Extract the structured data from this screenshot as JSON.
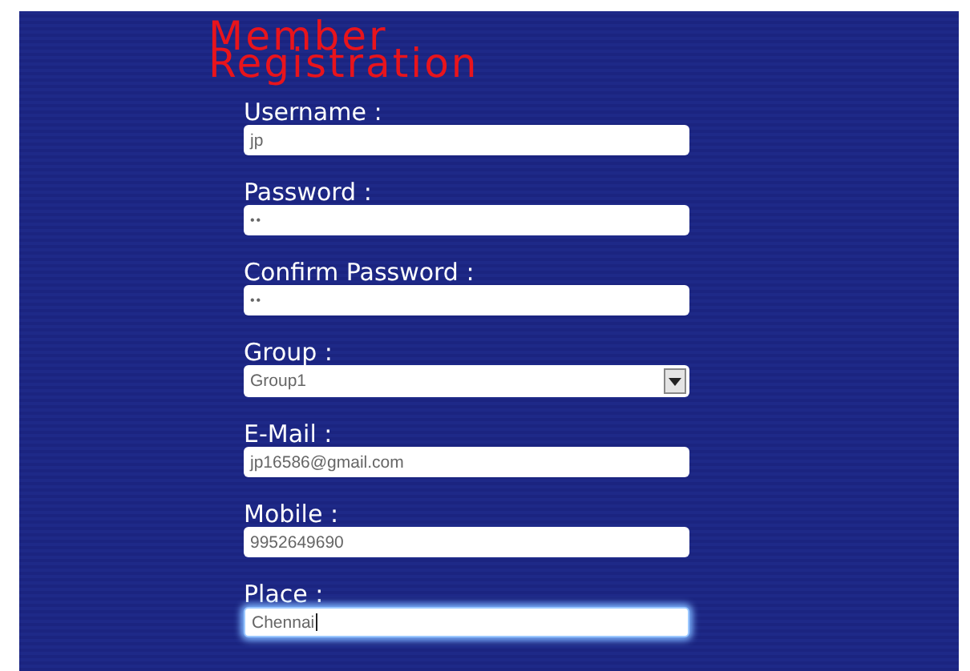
{
  "title": "Member Registration",
  "fields": [
    {
      "label": "Username :",
      "kind": "text",
      "value": "jp",
      "focused": false
    },
    {
      "label": "Password :",
      "kind": "password",
      "value": "••",
      "focused": false
    },
    {
      "label": "Confirm Password :",
      "kind": "password",
      "value": "••",
      "focused": false
    },
    {
      "label": "Group :",
      "kind": "select",
      "value": "Group1",
      "focused": false
    },
    {
      "label": "E-Mail :",
      "kind": "text",
      "value": "jp16586@gmail.com",
      "focused": false
    },
    {
      "label": "Mobile :",
      "kind": "text",
      "value": "9952649690",
      "focused": false
    },
    {
      "label": "Place :",
      "kind": "text",
      "value": "Chennai",
      "focused": true
    }
  ]
}
